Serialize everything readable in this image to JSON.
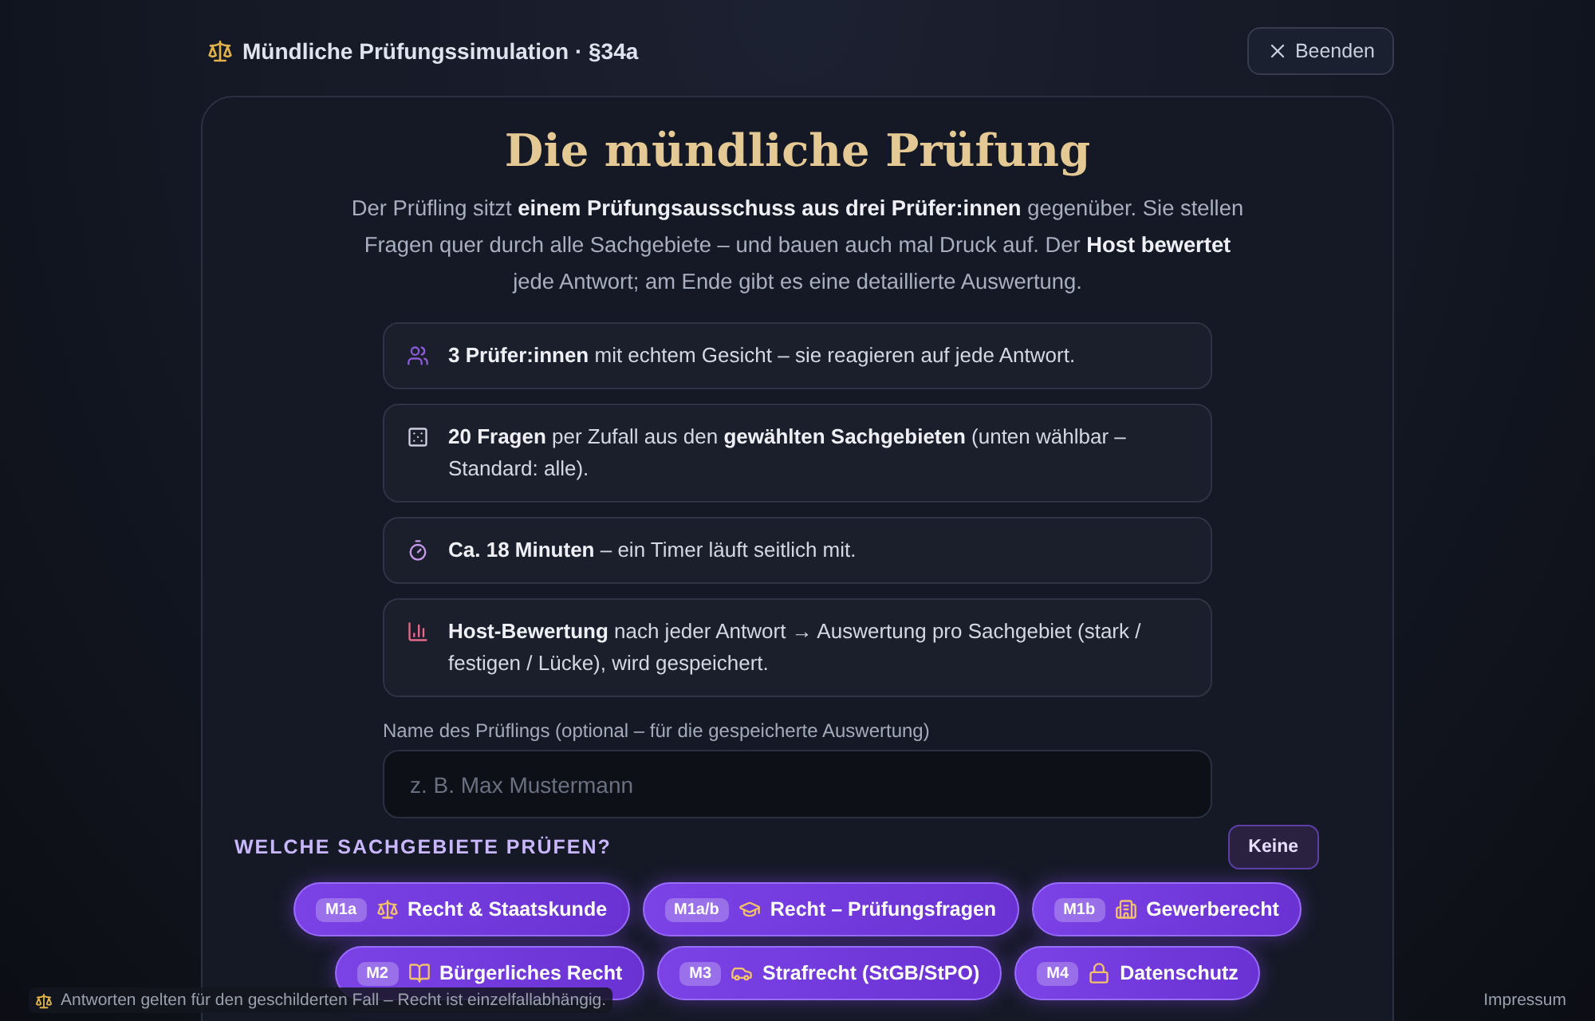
{
  "header": {
    "title": "Mündliche Prüfungssimulation · §34a",
    "close_button": "Beenden"
  },
  "intro": {
    "title": "Die mündliche Prüfung",
    "text": "Der Prüfling sitzt **einem Prüfungsausschuss aus drei Prüfer:innen** gegenüber. Sie stellen Fragen quer durch alle Sachgebiete – und bauen auch mal Druck auf. Der **Host bewertet** jede Antwort; am Ende gibt es eine detaillierte Auswertung."
  },
  "features": [
    {
      "text": "**3 Prüfer:innen** mit echtem Gesicht – sie reagieren auf jede Antwort."
    },
    {
      "text": "**20 Fragen** per Zufall aus den **gewählten Sachgebieten** (unten wählbar – Standard: alle)."
    },
    {
      "text": "**Ca. 18 Minuten** – ein Timer läuft seitlich mit."
    },
    {
      "text": "**Host-Bewertung** nach jeder Antwort → Auswertung pro Sachgebiet (stark / festigen / Lücke), wird gespeichert."
    }
  ],
  "name_field": {
    "label": "Name des Prüflings (optional – für die gespeicherte Auswertung)",
    "placeholder": "z. B. Max Mustermann"
  },
  "subjects": {
    "heading": "WELCHE SACHGEBIETE PRÜFEN?",
    "none_button": "Keine",
    "items": [
      {
        "code": "M1a",
        "label": "Recht & Staatskunde",
        "selected": true
      },
      {
        "code": "M1a/b",
        "label": "Recht – Prüfungsfragen",
        "selected": true
      },
      {
        "code": "M1b",
        "label": "Gewerberecht",
        "selected": true
      },
      {
        "code": "M2",
        "label": "Bürgerliches Recht",
        "selected": true
      },
      {
        "code": "M3",
        "label": "Strafrecht (StGB/StPO)",
        "selected": true
      },
      {
        "code": "M4",
        "label": "Datenschutz",
        "selected": true
      }
    ]
  },
  "footer": {
    "notice": "Antworten gelten für den geschilderten Fall – Recht ist einzelfallabhängig.",
    "link": "Impressum"
  }
}
